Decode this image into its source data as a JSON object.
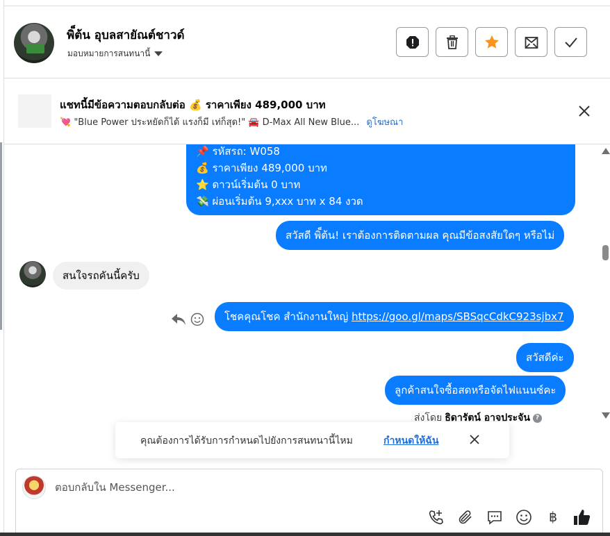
{
  "header": {
    "contact_name": "พิ็ต้น อุบลสายัณต์ชาวด์",
    "assign_label": "มอบหมายการสนทนานี้",
    "tools": [
      "spam-icon",
      "trash-icon",
      "star-icon",
      "mark-unread-icon",
      "done-icon"
    ]
  },
  "ad_banner": {
    "title": "แชทนี้มีข้อความตอบกลับต่อ 💰 ราคาเพียง 489,000 บาท",
    "subtitle": "💘 \"Blue Power ประหยัดก็ได้ แรงก็มี เท่ก็สุด!\" 🚘 D-Max All New Blue...",
    "link": "ดูโฆษณา"
  },
  "messages": {
    "car_details": [
      "📌 รหัสรถ: W058",
      "💰 ราคาเพียง 489,000 บาท",
      "⭐ ดาวน์เริ่มต้น 0 บาท",
      "💸 ผ่อนเริ่มต้น 9,xxx บาท x 84 งวด"
    ],
    "followup": "สวัสดี พิ็ต้น! เราต้องการติดตามผล คุณมีข้อสงสัยใดๆ หรือไม่",
    "customer_reply": "สนใจรถคันนี้ครับ",
    "location_prefix": "โชคคุณโชค สำนักงานใหญ่ ",
    "location_link": "https://goo.gl/maps/SBSqcCdkC923sjbx7",
    "greeting": "สวัสดีค่ะ",
    "question": "ลูกค้าสนใจซื้อสดหรือจัดไฟแนนซ์คะ",
    "sent_by_prefix": "ส่งโดย",
    "sent_by_name": "ธิดารัตน์ อาจประจัน"
  },
  "toast": {
    "text": "คุณต้องการได้รับการกำหนดไปยังการสนทนานี้ไหม",
    "link": "กำหนดให้ฉัน"
  },
  "composer": {
    "placeholder": "ตอบกลับใน Messenger...",
    "baht_symbol": "฿",
    "tools": [
      "call-icon",
      "attach-icon",
      "saved-reply-icon",
      "emoji-icon",
      "payment-icon",
      "like-icon"
    ]
  },
  "colors": {
    "outgoing_bubble": "#0a7cff",
    "incoming_bubble": "#f0f0f0",
    "link": "#1d6fd8",
    "star": "#f7931e"
  }
}
